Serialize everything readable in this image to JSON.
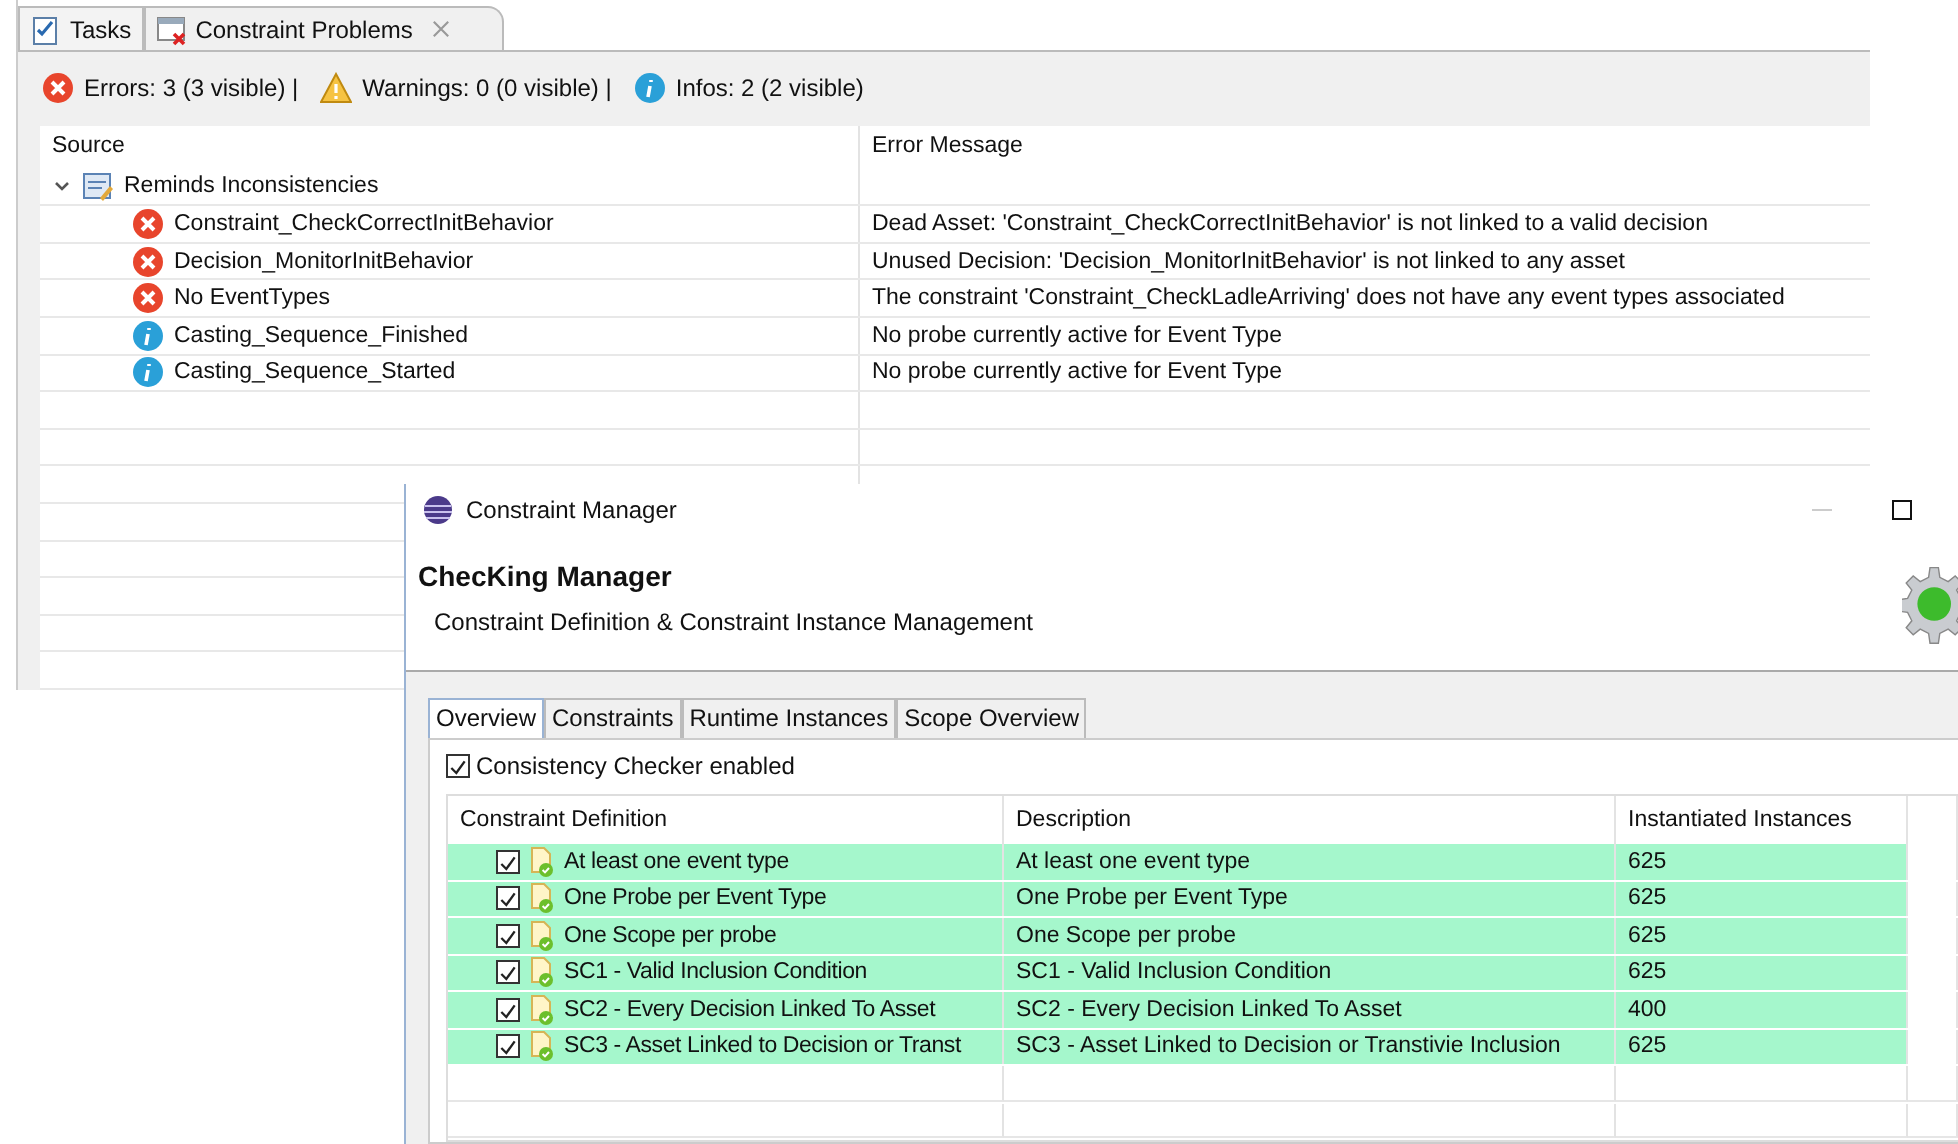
{
  "problems_view": {
    "tabs": [
      {
        "label": "Tasks",
        "selected": false,
        "closable": false
      },
      {
        "label": "Constraint Problems",
        "selected": true,
        "closable": true
      }
    ],
    "summary": [
      {
        "kind": "error",
        "text": "Errors: 3 (3 visible) |"
      },
      {
        "kind": "warning",
        "text": "Warnings: 0 (0 visible) |"
      },
      {
        "kind": "info",
        "text": "Infos: 2 (2 visible)"
      }
    ],
    "columns": [
      "Source",
      "Error Message"
    ],
    "tree": {
      "label": "Reminds Inconsistencies",
      "expanded": true,
      "children": [
        {
          "kind": "error",
          "source": "Constraint_CheckCorrectInitBehavior",
          "message": "Dead Asset: 'Constraint_CheckCorrectInitBehavior' is not linked to a valid decision"
        },
        {
          "kind": "error",
          "source": "Decision_MonitorInitBehavior",
          "message": "Unused Decision: 'Decision_MonitorInitBehavior' is not linked to any asset"
        },
        {
          "kind": "error",
          "source": "No EventTypes",
          "message": "The constraint 'Constraint_CheckLadleArriving' does not have any event types associated"
        },
        {
          "kind": "info",
          "source": "Casting_Sequence_Finished",
          "message": "No probe currently active for Event Type"
        },
        {
          "kind": "info",
          "source": "Casting_Sequence_Started",
          "message": "No probe currently active for Event Type"
        }
      ]
    }
  },
  "manager_window": {
    "title": "Constraint Manager",
    "heading": "ChecKing Manager",
    "subtitle": "Constraint Definition & Constraint Instance Management",
    "tabs": [
      {
        "label": "Overview",
        "selected": true
      },
      {
        "label": "Constraints",
        "selected": false
      },
      {
        "label": "Runtime Instances",
        "selected": false
      },
      {
        "label": "Scope Overview",
        "selected": false
      }
    ],
    "checker": {
      "label": "Consistency Checker enabled",
      "checked": true
    },
    "columns": [
      "Constraint Definition",
      "Description",
      "Instantiated Instances"
    ],
    "rows": [
      {
        "checked": true,
        "definition": "At least one event type",
        "description": "At least one event type",
        "instances": "625"
      },
      {
        "checked": true,
        "definition": "One Probe per Event Type",
        "description": "One Probe per Event Type",
        "instances": "625"
      },
      {
        "checked": true,
        "definition": "One Scope per probe",
        "description": "One Scope per probe",
        "instances": "625"
      },
      {
        "checked": true,
        "definition": "SC1 - Valid Inclusion Condition",
        "description": "SC1 - Valid Inclusion Condition",
        "instances": "625"
      },
      {
        "checked": true,
        "definition": "SC2 - Every Decision Linked To Asset",
        "description": "SC2 - Every Decision Linked To Asset",
        "instances": "400"
      },
      {
        "checked": true,
        "definition": "SC3 - Asset Linked to Decision or Transt",
        "description": "SC3 - Asset Linked to Decision or Transtivie Inclusion",
        "instances": "625"
      }
    ]
  }
}
